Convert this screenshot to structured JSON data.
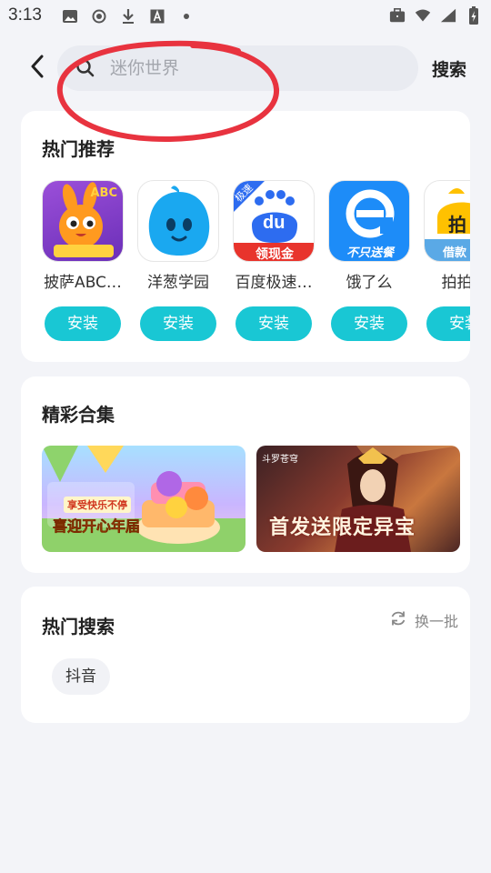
{
  "status_bar": {
    "time": "3:13",
    "left_icons": [
      "image-icon",
      "record-icon",
      "download-icon",
      "a-box-icon",
      "dot-icon"
    ],
    "right_icons": [
      "briefcase-icon",
      "wifi-icon",
      "signal-icon",
      "battery-charging-icon"
    ]
  },
  "header": {
    "back_icon": "back-arrow-icon",
    "search_placeholder": "迷你世界",
    "search_button": "搜索"
  },
  "hot_recommend": {
    "title": "热门推荐",
    "apps": [
      {
        "name": "披萨ABC…",
        "install": "安装",
        "icon": "pizza-abc-rabbit-icon",
        "badge": "ABC"
      },
      {
        "name": "洋葱学园",
        "install": "安装",
        "icon": "onion-academy-icon"
      },
      {
        "name": "百度极速…",
        "install": "安装",
        "icon": "baidu-lite-icon",
        "badge_top": "极速",
        "badge_text": "du",
        "badge_bottom": "领现金"
      },
      {
        "name": "饿了么",
        "install": "安装",
        "icon": "eleme-icon",
        "badge_bottom": "不只送餐"
      },
      {
        "name": "拍拍贷",
        "install": "安装",
        "icon": "paipaidai-icon",
        "badge_mid": "拍",
        "badge_bottom": "借款"
      }
    ]
  },
  "collections": {
    "title": "精彩合集",
    "banners": [
      {
        "name": "happy-game-banner",
        "subtitle": "享受快乐不停",
        "text": "喜迎开心年届"
      },
      {
        "name": "fantasy-game-banner",
        "brand": "斗罗苍穹",
        "text": "首发送限定异宝"
      }
    ]
  },
  "hot_search": {
    "title": "热门搜索",
    "refresh_label": "换一批",
    "refresh_icon": "refresh-icon",
    "tags": [
      "抖音"
    ]
  },
  "colors": {
    "install_button": "#19c7d4",
    "search_bg": "#e9ebf1",
    "page_bg": "#f3f4f8",
    "annotation": "#e8333f"
  }
}
